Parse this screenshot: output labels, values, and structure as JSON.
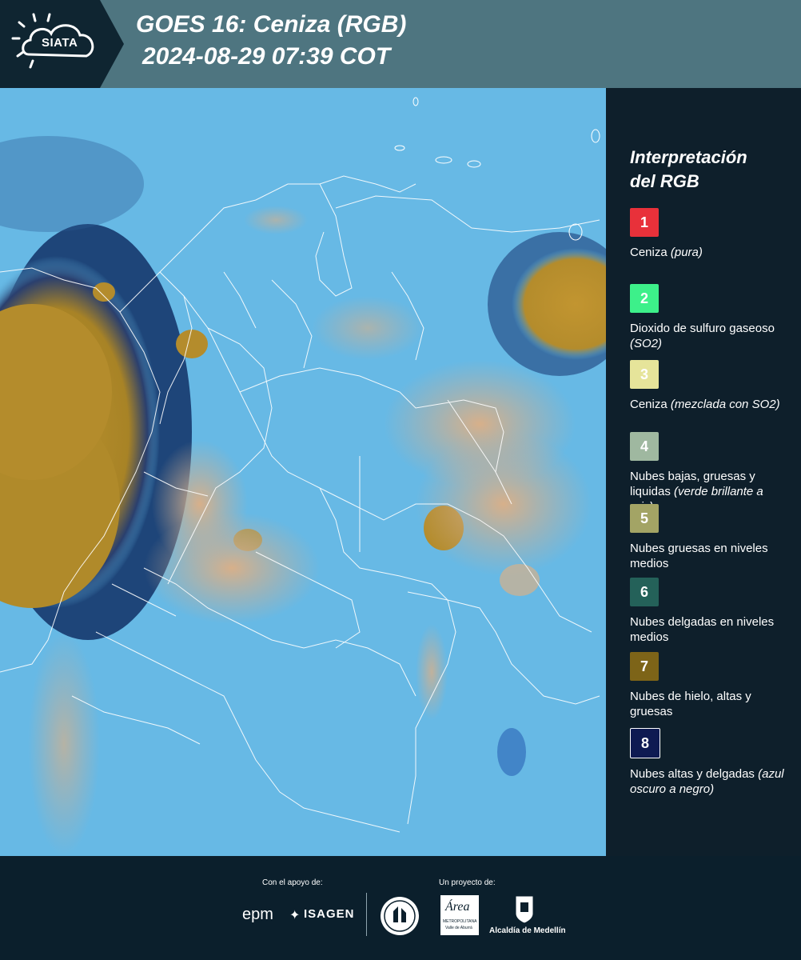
{
  "header": {
    "logo_text": "SIATA",
    "title": "GOES 16: Ceniza (RGB)",
    "datetime": "2024-08-29 07:39 COT"
  },
  "legend": {
    "title_line1": "Interpretación",
    "title_line2": "del RGB",
    "items": [
      {
        "number": "1",
        "color": "#e8313a",
        "label": "Ceniza ",
        "note": "(pura)"
      },
      {
        "number": "2",
        "color": "#3df08a",
        "label": "Dioxido de sulfuro gaseoso ",
        "note": "(SO2)"
      },
      {
        "number": "3",
        "color": "#e6e49a",
        "label": "Ceniza ",
        "note": "(mezclada con SO2)"
      },
      {
        "number": "4",
        "color": "#9fb8a0",
        "label": "Nubes bajas, gruesas y liquidas ",
        "note": "(verde brillante a gris)"
      },
      {
        "number": "5",
        "color": "#a3a465",
        "label": "Nubes gruesas en niveles medios",
        "note": ""
      },
      {
        "number": "6",
        "color": "#246159",
        "label": "Nubes delgadas en niveles medios",
        "note": ""
      },
      {
        "number": "7",
        "color": "#7d6418",
        "label": "Nubes de hielo, altas y gruesas",
        "note": ""
      },
      {
        "number": "8",
        "color": "#0e1a52",
        "label": "Nubes altas y delgadas ",
        "note": "(azul oscuro a negro)"
      }
    ]
  },
  "footer": {
    "support_label": "Con el apoyo de:",
    "project_label": "Un proyecto de:",
    "sponsor1": "epm",
    "sponsor2": "ISAGEN",
    "partner1": "Área",
    "partner1_sub": "METROPOLITANA",
    "partner1_sub2": "Valle de Aburrá",
    "partner2": "Alcaldía de Medellín"
  },
  "map": {
    "background_color": "#5fb6e3",
    "ice_cloud_color": "#b48c2c"
  }
}
